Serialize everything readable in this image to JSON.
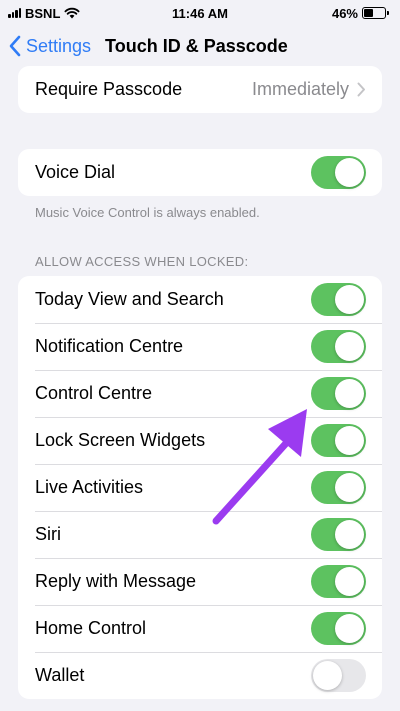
{
  "status": {
    "carrier": "BSNL",
    "time": "11:46 AM",
    "battery": "46%",
    "battery_level": 0.46
  },
  "nav": {
    "back_label": "Settings",
    "title": "Touch ID & Passcode"
  },
  "require_passcode": {
    "label": "Require Passcode",
    "value": "Immediately"
  },
  "voice_dial": {
    "label": "Voice Dial",
    "on": true,
    "footnote": "Music Voice Control is always enabled."
  },
  "locked_section": {
    "header": "ALLOW ACCESS WHEN LOCKED:",
    "items": [
      {
        "label": "Today View and Search",
        "on": true
      },
      {
        "label": "Notification Centre",
        "on": true
      },
      {
        "label": "Control Centre",
        "on": true
      },
      {
        "label": "Lock Screen Widgets",
        "on": true
      },
      {
        "label": "Live Activities",
        "on": true
      },
      {
        "label": "Siri",
        "on": true
      },
      {
        "label": "Reply with Message",
        "on": true
      },
      {
        "label": "Home Control",
        "on": true
      },
      {
        "label": "Wallet",
        "on": false
      }
    ]
  },
  "colors": {
    "accent": "#2f7cf6",
    "toggle_on": "#5dc260",
    "annotation_arrow": "#9b3bf0"
  }
}
